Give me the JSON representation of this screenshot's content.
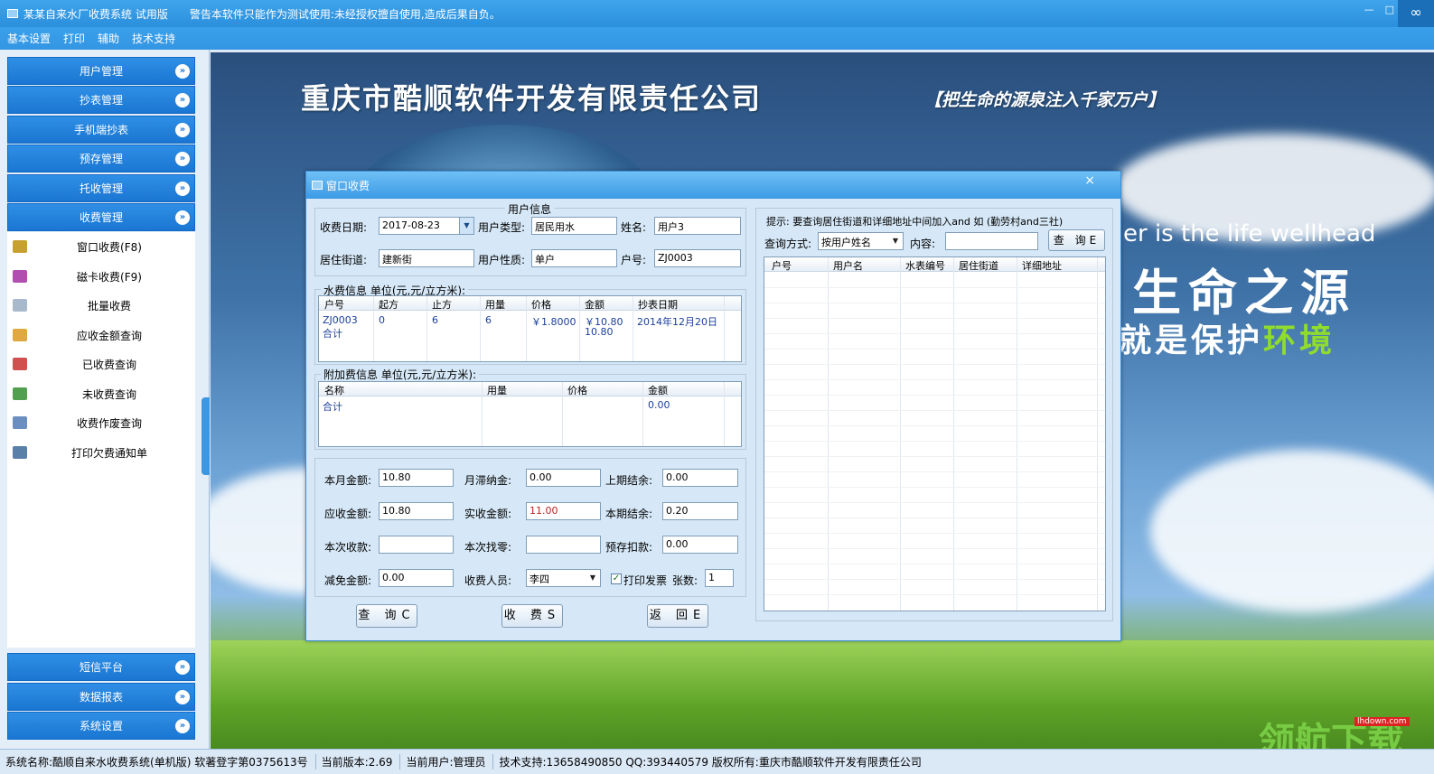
{
  "window": {
    "title": "某某自来水厂收费系统 试用版",
    "warning": "警告本软件只能作为测试使用:未经授权擅自使用,造成后果自负。",
    "corner_icon": "link-icon"
  },
  "menu": [
    "基本设置",
    "打印",
    "辅助",
    "技术支持"
  ],
  "sidebar": {
    "top_groups": [
      "用户管理",
      "抄表管理",
      "手机端抄表",
      "预存管理",
      "托收管理",
      "收费管理"
    ],
    "sub_items": [
      {
        "label": "窗口收费(F8)",
        "icon": "pencil-icon",
        "color": "#c8a030"
      },
      {
        "label": "磁卡收费(F9)",
        "icon": "card-icon",
        "color": "#b04fb0"
      },
      {
        "label": "批量收费",
        "icon": "copy-icon",
        "color": "#a9b9cc"
      },
      {
        "label": "应收金额查询",
        "icon": "chat-icon",
        "color": "#e0a840"
      },
      {
        "label": "已收费查询",
        "icon": "list-icon",
        "color": "#d05050"
      },
      {
        "label": "未收费查询",
        "icon": "arrow-icon",
        "color": "#50a050"
      },
      {
        "label": "收费作废查询",
        "icon": "mail-icon",
        "color": "#6a8fc0"
      },
      {
        "label": "打印欠费通知单",
        "icon": "doc-icon",
        "color": "#5a7fa8"
      }
    ],
    "bottom_groups": [
      "短信平台",
      "数据报表",
      "系统设置"
    ]
  },
  "banner": {
    "company": "重庆市酷顺软件开发有限责任公司",
    "slogan": "【把生命的源泉注入千家万户】",
    "english": "er is the life wellhead",
    "big_line1": "生命之源",
    "big_line2_a": "就是保护",
    "big_line2_b": "环境",
    "watermark": "领航下载",
    "watermark_url": "lhdown.com"
  },
  "dialog": {
    "title": "窗口收费",
    "close": "×",
    "user_info_title": "用户信息",
    "labels": {
      "date": "收费日期:",
      "user_type": "用户类型:",
      "name": "姓名:",
      "street": "居住街道:",
      "user_nature": "用户性质:",
      "account": "户号:"
    },
    "values": {
      "date": "2017-08-23",
      "user_type": "居民用水",
      "name": "用户3",
      "street": "建新街",
      "user_nature": "单户",
      "account": "ZJ0003"
    },
    "water_title": "水费信息 单位(元,元/立方米):",
    "water_headers": [
      "户号",
      "起方",
      "止方",
      "用量",
      "价格",
      "金额",
      "抄表日期"
    ],
    "water_rows": [
      [
        "ZJ0003",
        "0",
        "6",
        "6",
        "￥1.8000",
        "￥10.80",
        "2014年12月20日"
      ],
      [
        "合计",
        "",
        "",
        "",
        "",
        "10.80",
        ""
      ]
    ],
    "extra_title": "附加费信息 单位(元,元/立方米):",
    "extra_headers": [
      "名称",
      "用量",
      "价格",
      "金额"
    ],
    "extra_rows": [
      [
        "合计",
        "",
        "",
        "0.00"
      ]
    ],
    "money_labels": {
      "month_amount": "本月金额:",
      "late_fee": "月滞纳金:",
      "last_balance": "上期结余:",
      "receivable": "应收金额:",
      "actual": "实收金额:",
      "this_balance": "本期结余:",
      "this_receipt": "本次收款:",
      "change": "本次找零:",
      "prepaid": "预存扣款:",
      "discount": "减免金额:",
      "collector": "收费人员:",
      "print_invoice": "打印发票",
      "sheets": "张数:"
    },
    "money_values": {
      "month_amount": "10.80",
      "late_fee": "0.00",
      "last_balance": "0.00",
      "receivable": "10.80",
      "actual": "11.00",
      "this_balance": "0.20",
      "this_receipt": "",
      "change": "",
      "prepaid": "0.00",
      "discount": "0.00",
      "collector": "李四",
      "sheets": "1"
    },
    "buttons": {
      "query": "查 询C",
      "charge": "收 费S",
      "back": "返 回E"
    },
    "hint": "提示: 要查询居住街道和详细地址中间加入and 如 (勤劳村and三社)",
    "query_method_label": "查询方式:",
    "query_method_value": "按用户姓名",
    "content_label": "内容:",
    "content_value": "",
    "query_button": "查 询E",
    "result_headers": [
      "户号",
      "用户名",
      "水表编号",
      "居住街道",
      "详细地址"
    ]
  },
  "status": [
    "系统名称:酷顺自来水收费系统(单机版) 软著登字第0375613号",
    "当前版本:2.69",
    "当前用户:管理员",
    "技术支持:13658490850 QQ:393440579 版权所有:重庆市酷顺软件开发有限责任公司"
  ]
}
